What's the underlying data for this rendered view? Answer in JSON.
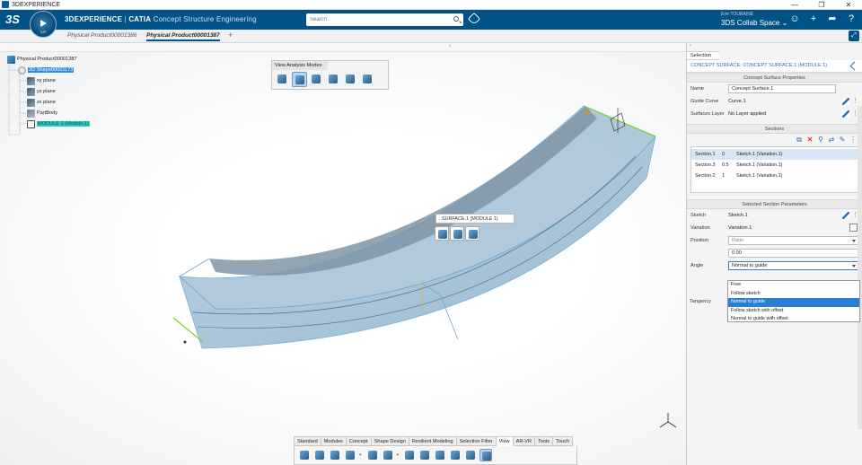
{
  "os": {
    "title": "3DEXPERIENCE",
    "controls": [
      "—",
      "❐",
      "✕"
    ]
  },
  "header": {
    "brand_bold": "3DEXPERIENCE",
    "brand_sep": " | ",
    "brand_app": "CATIA",
    "brand_role": "Concept Structure Engineering",
    "compass_label": "V,R",
    "search_placeholder": "Search",
    "user_name": "Emr TOURAINE",
    "collab_space": "3DS Collab Space ⌄",
    "accent": "#005386"
  },
  "tabs": {
    "items": [
      {
        "label": "Physical Product00001386"
      },
      {
        "label": "Physical Product00001387"
      }
    ],
    "plus": "+",
    "expand": "⤢"
  },
  "tree": {
    "nodes": [
      {
        "label": "Physical Product00001387"
      },
      {
        "label": "3D Shape00001173"
      },
      {
        "label": "xy plane"
      },
      {
        "label": "yz plane"
      },
      {
        "label": "zx plane"
      },
      {
        "label": "PartBody"
      },
      {
        "label": "MODULE 1 (Module.1)"
      }
    ]
  },
  "analysis": {
    "title": "View Analysis Modes"
  },
  "context": {
    "label": "..SURFACE.1 (MODULE 1)"
  },
  "action_bar": {
    "tabs": [
      "Standard",
      "Modules",
      "Concept",
      "Shape Design",
      "Resilient Modeling",
      "Selection Filter",
      "View",
      "AR-VR",
      "Tools",
      "Touch"
    ],
    "active": "View",
    "dropdown_mark": "▾"
  },
  "panel": {
    "collapse": "›",
    "selection_tab": "Selection",
    "headline": "CONCEPT SURFACE: CONCEPT SURFACE.1 (MODULE 1)",
    "props_title": "Concept Surface Properties",
    "name_label": "Name",
    "name_value": "Concept Surface.1",
    "guide_label": "Guide Curve",
    "guide_value": "Curve.1",
    "layer_label": "Surfaces Layer",
    "layer_value": "No Layer applied",
    "sections_title": "Sections",
    "sections": [
      {
        "name": "Section.1",
        "pos": "0",
        "sketch": "Sketch.1 (Variation.1)"
      },
      {
        "name": "Section.3",
        "pos": "0.5",
        "sketch": "Sketch.1 (Variation.1)"
      },
      {
        "name": "Section.2",
        "pos": "1",
        "sketch": "Sketch.1 (Variation.1)"
      }
    ],
    "selected_title": "Selected Section Parameters",
    "sketch_label": "Sketch",
    "sketch_value": "Sketch.1",
    "variation_label": "Variation",
    "variation_value": "Variation.1",
    "position_label": "Position",
    "position_value": "Ratio",
    "ratio_value": "0.00",
    "angle_label": "Angle",
    "angle_value": "Normal to guide",
    "angle_options": [
      "Free",
      "Follow sketch",
      "Normal to guide",
      "Follow sketch with offset",
      "Normal to guide with offset"
    ],
    "tangency_label": "Tangency",
    "dots": "⋮"
  }
}
